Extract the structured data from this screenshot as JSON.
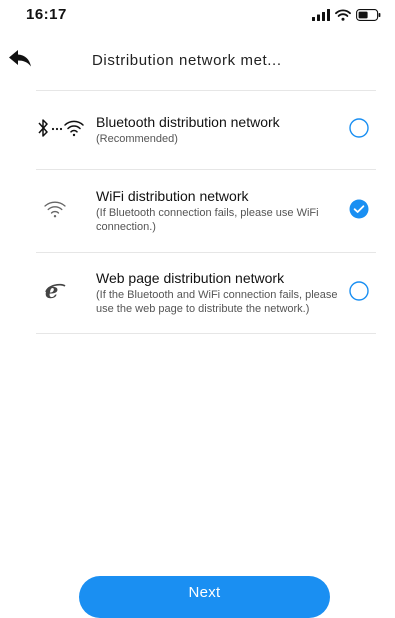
{
  "status_bar": {
    "time": "16:17",
    "icons": [
      "cellular-signal-icon",
      "wifi-icon",
      "battery-icon"
    ]
  },
  "header": {
    "title": "Distribution network met...",
    "back_icon": "back-arrow-icon"
  },
  "options": [
    {
      "title": "Bluetooth distribution network",
      "subtitle": "(Recommended)",
      "icon": "bluetooth-wifi-icon",
      "selected": false
    },
    {
      "title": "WiFi distribution network",
      "subtitle": "(If Bluetooth connection fails, please use WiFi connection.)",
      "icon": "wifi-icon",
      "selected": true
    },
    {
      "title": "Web page distribution network",
      "subtitle": "(If the Bluetooth and WiFi connection fails, please use the web page to distribute the network.)",
      "icon": "browser-e-icon",
      "selected": false
    }
  ],
  "footer": {
    "next_label": "Next"
  },
  "colors": {
    "accent": "#1a8ff2",
    "divider": "#e6e6e6"
  }
}
